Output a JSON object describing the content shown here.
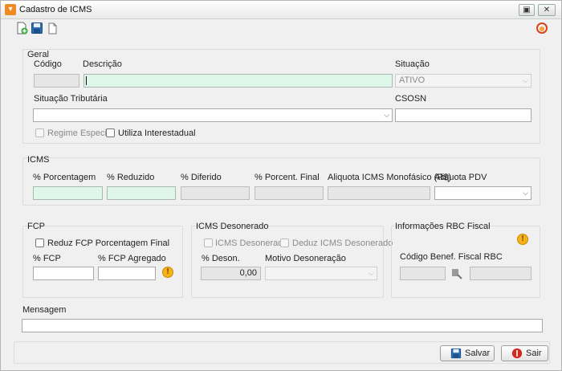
{
  "window": {
    "title": "Cadastro de ICMS"
  },
  "geral": {
    "section_title": "Geral",
    "codigo_label": "Código",
    "codigo_value": "",
    "descricao_label": "Descrição",
    "descricao_value": "",
    "situacao_label": "Situação",
    "situacao_value": "ATIVO",
    "situacao_tributaria_label": "Situação Tributária",
    "situacao_tributaria_value": "",
    "csosn_label": "CSOSN",
    "csosn_value": "",
    "regime_especial_label": "Regime Especial",
    "utiliza_interestadual_label": "Utiliza Interestadual"
  },
  "icms": {
    "section_title": "ICMS",
    "porcentagem_label": "% Porcentagem",
    "reduzido_label": "% Reduzido",
    "diferido_label": "% Diferido",
    "porcent_final_label": "% Porcent. Final",
    "aliquota_monofasico_label": "Aliquota ICMS Monofásico (R$)",
    "aliquota_pdv_label": "Aliquota PDV",
    "porcentagem_value": "",
    "reduzido_value": "",
    "diferido_value": "",
    "porcent_final_value": "",
    "aliquota_monofasico_value": "",
    "aliquota_pdv_value": ""
  },
  "fcp": {
    "section_title": "FCP",
    "reduz_label": "Reduz FCP Porcentagem Final",
    "fcp_label": "% FCP",
    "fcp_agregado_label": "% FCP Agregado",
    "fcp_value": "",
    "fcp_agregado_value": ""
  },
  "icms_desonerado": {
    "section_title": "ICMS Desonerado",
    "icms_desonerado_chk_label": "ICMS Desonerado",
    "deduz_label": "Deduz ICMS Desonerado",
    "deson_label": "% Deson.",
    "deson_value": "0,00",
    "motivo_label": "Motivo Desoneração",
    "motivo_value": ""
  },
  "rbc": {
    "section_title": "Informações RBC Fiscal",
    "codigo_label": "Código Benef. Fiscal RBC",
    "codigo_value": "",
    "descricao_value": ""
  },
  "mensagem": {
    "label": "Mensagem",
    "value": ""
  },
  "footer": {
    "salvar_label": "Salvar",
    "sair_label": "Sair"
  },
  "colors": {
    "green_field": "#dff7ea",
    "warning": "#f5b21b",
    "sair_icon": "#d8261c",
    "save_icon": "#2b6cb3"
  },
  "icons": [
    "new-doc-icon",
    "save-icon",
    "copy-icon",
    "refresh-icon",
    "warning-icon",
    "search-icon",
    "app-icon"
  ]
}
